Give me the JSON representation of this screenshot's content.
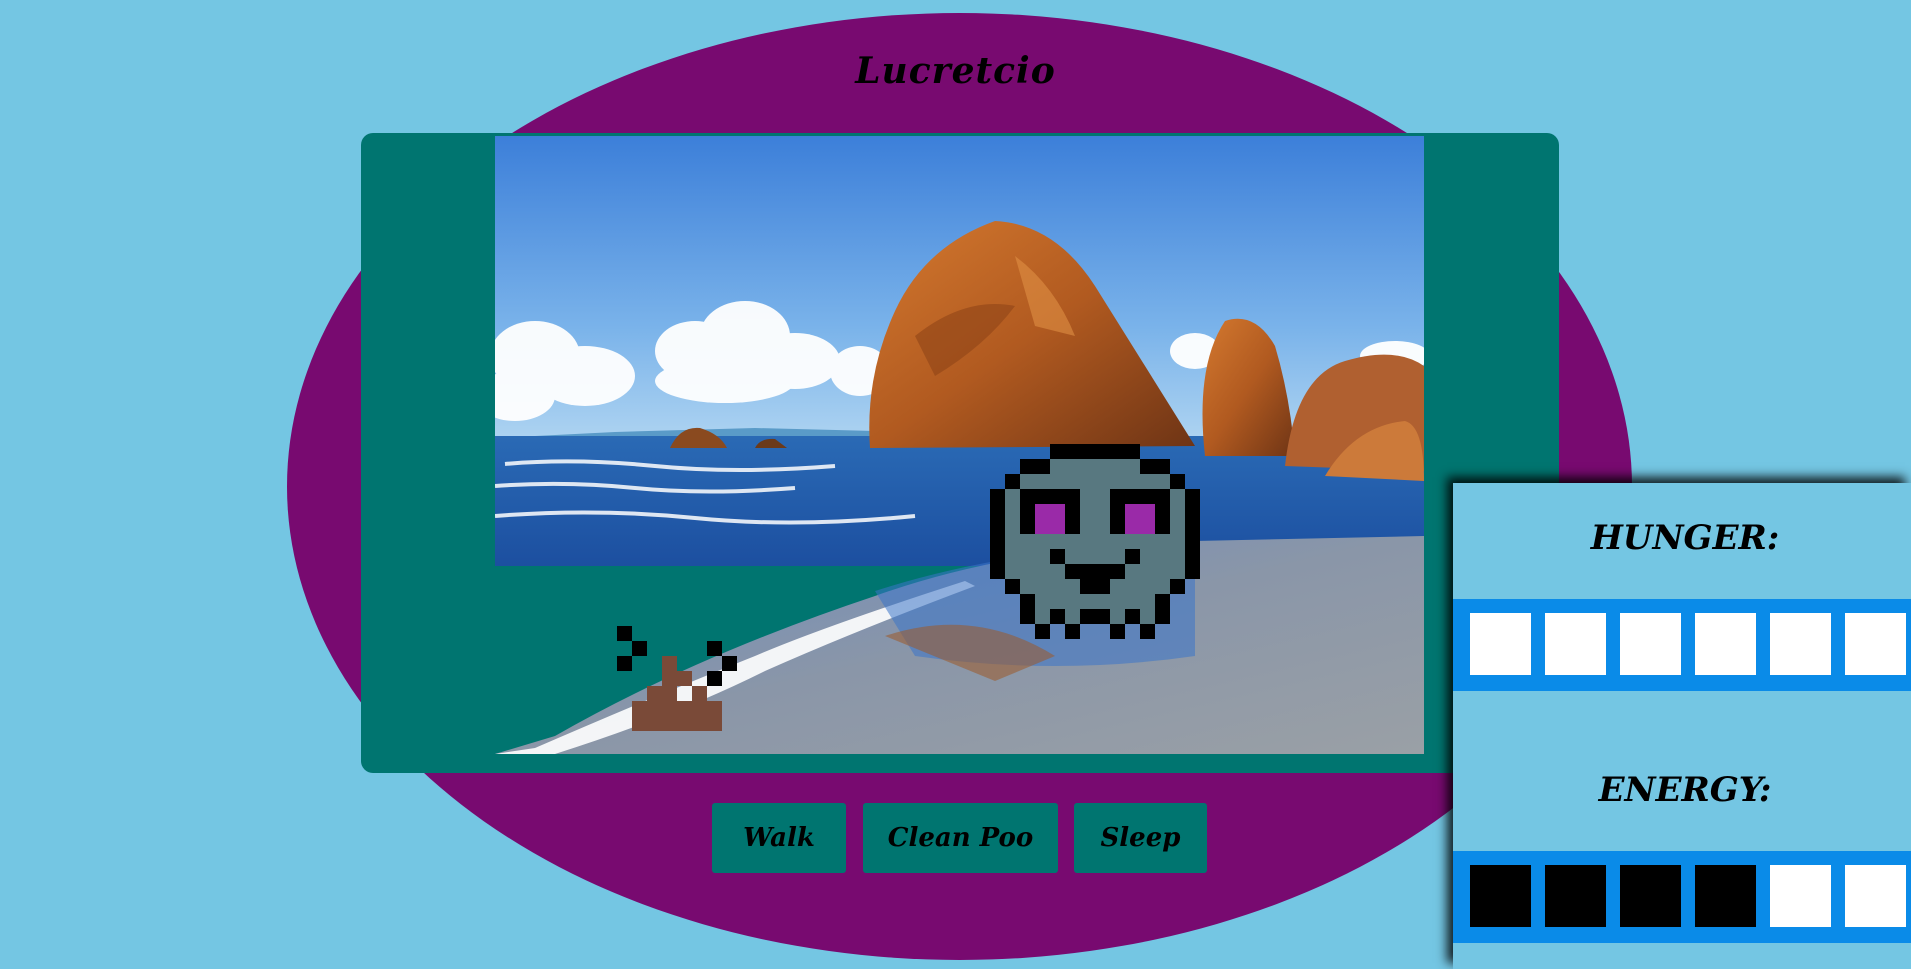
{
  "pet": {
    "name": "Lucretcio",
    "sprite": "grey-ghost-pet",
    "has_poo": true
  },
  "scene": {
    "background": "beach-with-rocks"
  },
  "actions": [
    {
      "label": "Walk"
    },
    {
      "label": "Clean Poo"
    },
    {
      "label": "Sleep"
    }
  ],
  "stats": {
    "hunger": {
      "label": "HUNGER:",
      "level": 0,
      "cells_visible": 6
    },
    "energy": {
      "label": "ENERGY:",
      "level": 4,
      "cells_visible": 6
    }
  },
  "colors": {
    "background": "#74c6e3",
    "egg": "#780a70",
    "frame": "#007570",
    "bar": "#0a8be8",
    "cell_empty": "#ffffff",
    "cell_full": "#000000"
  }
}
